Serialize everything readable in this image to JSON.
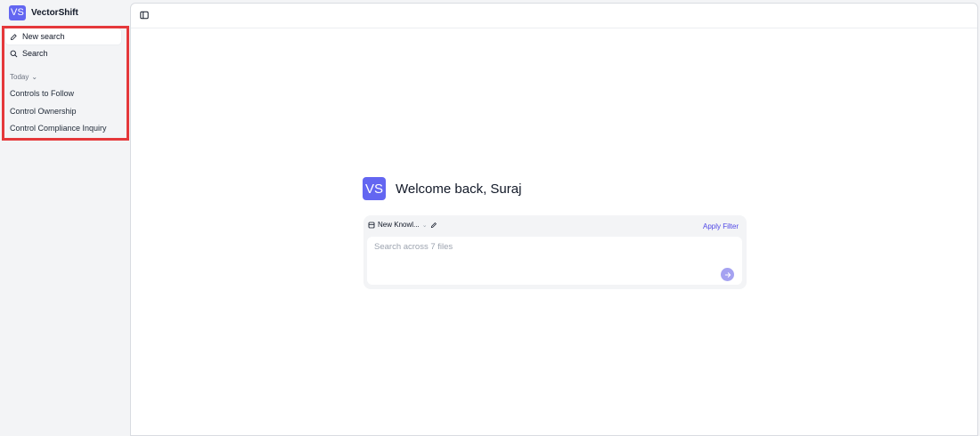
{
  "brand": {
    "logo_text": "VS",
    "name": "VectorShift",
    "color": "#6366f1"
  },
  "sidebar": {
    "nav": [
      {
        "label": "New search",
        "icon": "edit-icon",
        "active": true
      },
      {
        "label": "Search",
        "icon": "search-icon",
        "active": false
      }
    ],
    "section_label": "Today",
    "history": [
      {
        "label": "Controls to Follow"
      },
      {
        "label": "Control Ownership"
      },
      {
        "label": "Control Compliance Inquiry"
      }
    ],
    "highlight_color": "#e5383b"
  },
  "main": {
    "welcome_logo": "VS",
    "welcome_text": "Welcome back, Suraj",
    "search": {
      "knowledge_base": "New Knowl...",
      "apply_filter": "Apply Filter",
      "placeholder": "Search across 7 files"
    },
    "accent_color": "#4f46e5"
  }
}
